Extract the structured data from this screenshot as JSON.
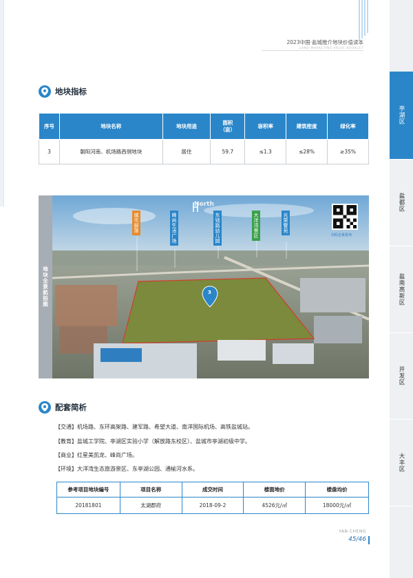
{
  "header": {
    "title": "2023中国·盐城推介地块价值读本",
    "subtitle": "LAND MARKETING VALUE BOOKLET"
  },
  "tabs": [
    {
      "label": "亭湖区",
      "active": true
    },
    {
      "label": "盐都区",
      "active": false
    },
    {
      "label": "盐南高新区",
      "active": false
    },
    {
      "label": "开发区",
      "active": false
    },
    {
      "label": "大丰区",
      "active": false
    }
  ],
  "indicators": {
    "heading": "地块指标",
    "headers": [
      "序号",
      "地块名称",
      "地块用途",
      "面积\n（亩）",
      "容积率",
      "建筑密度",
      "绿化率"
    ],
    "row": [
      "3",
      "朝阳河南、机场路西侧地块",
      "居住",
      "59.7",
      "≤1.3",
      "≤28%",
      "≥35%"
    ]
  },
  "photo": {
    "side_label": "地块全景航拍图",
    "north_label": "North",
    "plot_marker": "3",
    "qr_caption": "扫码全景看地",
    "pois": [
      {
        "label": "城市部落",
        "color": "#e88a2a"
      },
      {
        "label": "峰尚生活广场",
        "color": "#2a86c9"
      },
      {
        "label": "东钱路幼儿园",
        "color": "#2a86c9"
      },
      {
        "label": "大洋湾景区",
        "color": "#3aa14a"
      },
      {
        "label": "光荣警苑",
        "color": "#2a86c9"
      }
    ]
  },
  "amenities": {
    "heading": "配套简析",
    "items": [
      "【交通】机场路、东环高架路、建军路、希望大道、南洋国际机场、高铁盐城站。",
      "【教育】盐城工学院、亭湖区实验小学（解放路东校区）、盐城市亭湖初级中学。",
      "【商业】红星美凯龙、峰尚广场。",
      "【环境】大洋湾生态旅游景区、东亭湖公园、通榆河水系。"
    ]
  },
  "reference": {
    "headers": [
      "参考项目地块编号",
      "项目名称",
      "成交时间",
      "楼面地价",
      "楼盘均价"
    ],
    "row": [
      "20181801",
      "太湖郡府",
      "2018-09-2",
      "4526元/㎡",
      "18000元/㎡"
    ]
  },
  "footer": {
    "brand": "YAN CHENG",
    "page": "45/46"
  }
}
